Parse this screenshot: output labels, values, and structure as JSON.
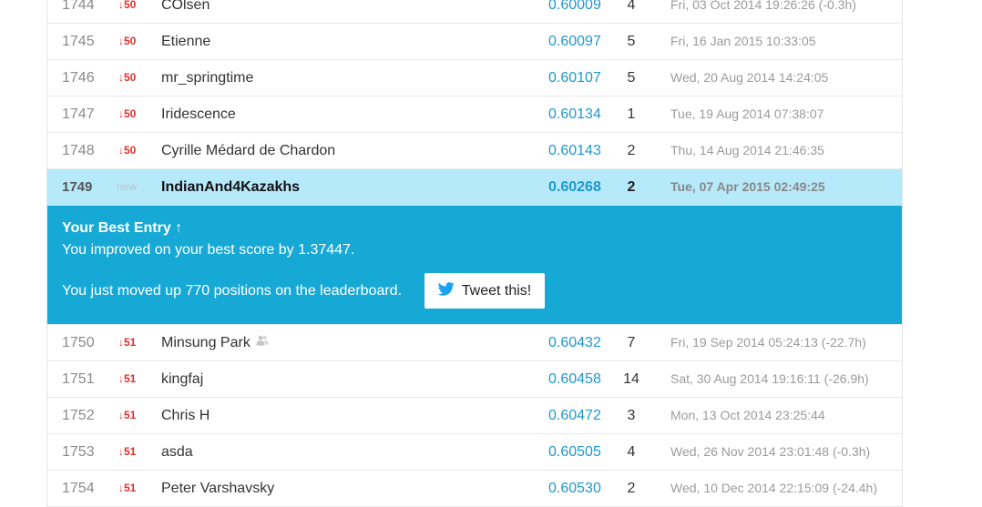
{
  "leaderboard": {
    "rows_before": [
      {
        "rank": "1744",
        "delta": "↓50",
        "team": "COlsen",
        "score": "0.60009",
        "entries": "4",
        "last": "Fri, 03 Oct 2014 19:26:26 (-0.3h)"
      },
      {
        "rank": "1745",
        "delta": "↓50",
        "team": "Etienne",
        "score": "0.60097",
        "entries": "5",
        "last": "Fri, 16 Jan 2015 10:33:05"
      },
      {
        "rank": "1746",
        "delta": "↓50",
        "team": "mr_springtime",
        "score": "0.60107",
        "entries": "5",
        "last": "Wed, 20 Aug 2014 14:24:05"
      },
      {
        "rank": "1747",
        "delta": "↓50",
        "team": "Iridescence",
        "score": "0.60134",
        "entries": "1",
        "last": "Tue, 19 Aug 2014 07:38:07"
      },
      {
        "rank": "1748",
        "delta": "↓50",
        "team": "Cyrille Médard de Chardon",
        "score": "0.60143",
        "entries": "2",
        "last": "Thu, 14 Aug 2014 21:46:35"
      }
    ],
    "current_row": {
      "rank": "1749",
      "delta": "new",
      "team": "IndianAnd4Kazakhs",
      "score": "0.60268",
      "entries": "2",
      "last": "Tue, 07 Apr 2015 02:49:25"
    },
    "best_entry": {
      "title": "Your Best Entry ↑",
      "improved": "You improved on your best score by 1.37447.",
      "moved": "You just moved up 770 positions on the leaderboard.",
      "tweet_label": "Tweet this!"
    },
    "rows_after": [
      {
        "rank": "1750",
        "delta": "↓51",
        "team": "Minsung Park",
        "score": "0.60432",
        "entries": "7",
        "last": "Fri, 19 Sep 2014 05:24:13 (-22.7h)",
        "team_icon": "team-members-icon"
      },
      {
        "rank": "1751",
        "delta": "↓51",
        "team": "kingfaj",
        "score": "0.60458",
        "entries": "14",
        "last": "Sat, 30 Aug 2014 19:16:11 (-26.9h)"
      },
      {
        "rank": "1752",
        "delta": "↓51",
        "team": "Chris H",
        "score": "0.60472",
        "entries": "3",
        "last": "Mon, 13 Oct 2014 23:25:44"
      },
      {
        "rank": "1753",
        "delta": "↓51",
        "team": "asda",
        "score": "0.60505",
        "entries": "4",
        "last": "Wed, 26 Nov 2014 23:01:48 (-0.3h)"
      },
      {
        "rank": "1754",
        "delta": "↓51",
        "team": "Peter Varshavsky",
        "score": "0.60530",
        "entries": "2",
        "last": "Wed, 10 Dec 2014 22:15:09 (-24.4h)"
      }
    ]
  },
  "colors": {
    "highlight_row": "#b6e9fa",
    "best_entry_banner": "#17a9d6",
    "score_text": "#1b9ad0",
    "rank_drop": "#e0302a",
    "twitter_bird": "#1da1f2"
  }
}
